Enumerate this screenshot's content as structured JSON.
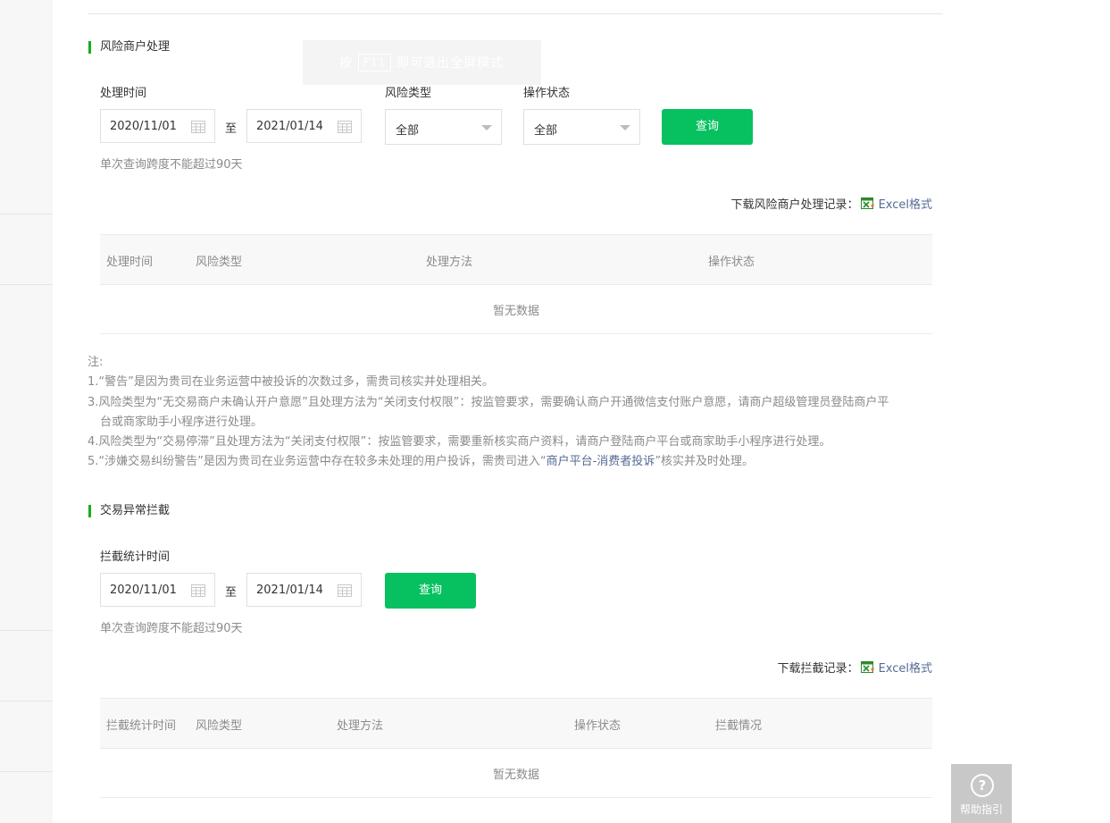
{
  "overlay": {
    "prefix": "按",
    "key": "F11",
    "suffix": "即可退出全屏模式"
  },
  "risk_section": {
    "title": "风险商户处理",
    "process_time_label": "处理时间",
    "start_date": "2020/11/01",
    "to_label": "至",
    "end_date": "2021/01/14",
    "risk_type_label": "风险类型",
    "risk_type_value": "全部",
    "op_status_label": "操作状态",
    "op_status_value": "全部",
    "query_button": "查询",
    "tip": "单次查询跨度不能超过90天",
    "download_label": "下载风险商户处理记录：",
    "download_link": "Excel格式",
    "table": {
      "headers": [
        "处理时间",
        "风险类型",
        "处理方法",
        "操作状态"
      ],
      "empty_text": "暂无数据"
    }
  },
  "notes": {
    "title": "注:",
    "lines": [
      "1.“警告”是因为贵司在业务运营中被投诉的次数过多，需贵司核实并处理相关。",
      "3.风险类型为“无交易商户未确认开户意愿”且处理方法为“关闭支付权限”：按监管要求，需要确认商户开通微信支付账户意愿，请商户超级管理员登陆商户平",
      "台或商家助手小程序进行处理。",
      "4.风险类型为“交易停滞”且处理方法为“关闭支付权限”：按监管要求，需要重新核实商户资料，请商户登陆商户平台或商家助手小程序进行处理。"
    ],
    "line5_prefix": "5.“涉嫌交易纠纷警告”是因为贵司在业务运营中存在较多未处理的用户投诉，需贵司进入“",
    "line5_link": "商户平台-消费者投诉",
    "line5_suffix": "”核实并及时处理。"
  },
  "intercept_section": {
    "title": "交易异常拦截",
    "time_label": "拦截统计时间",
    "start_date": "2020/11/01",
    "to_label": "至",
    "end_date": "2021/01/14",
    "query_button": "查询",
    "tip": "单次查询跨度不能超过90天",
    "download_label": "下载拦截记录：",
    "download_link": "Excel格式",
    "table": {
      "headers": [
        "拦截统计时间",
        "风险类型",
        "处理方法",
        "操作状态",
        "拦截情况"
      ],
      "empty_text": "暂无数据"
    }
  },
  "help": {
    "label": "帮助指引"
  },
  "colors": {
    "accent": "#07c160",
    "title_bar": "#1aad19",
    "link": "#576b95",
    "muted": "#8b8b8b"
  }
}
